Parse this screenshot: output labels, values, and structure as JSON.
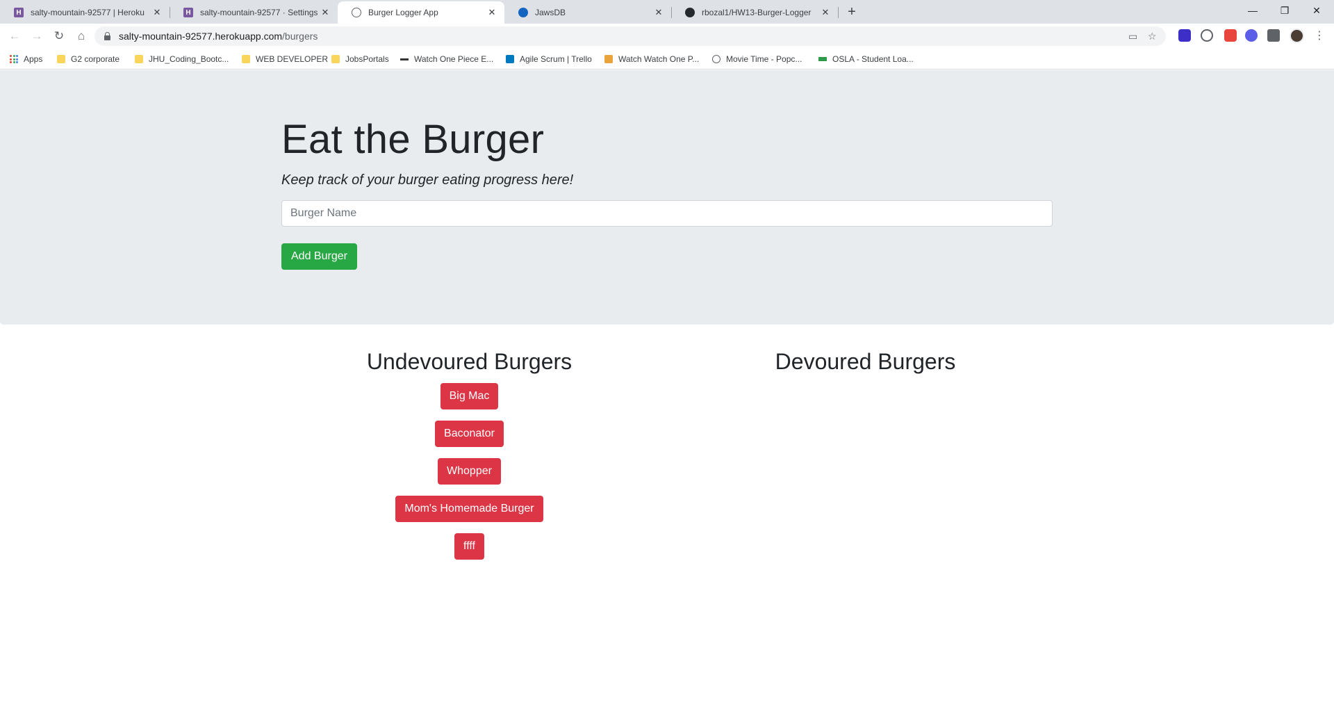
{
  "browser": {
    "tabs": [
      {
        "title": "salty-mountain-92577 | Heroku",
        "icon": "heroku-icon",
        "favicon_letter": "H",
        "close": "✕"
      },
      {
        "title": "salty-mountain-92577 · Settings |",
        "icon": "heroku-icon",
        "favicon_letter": "H",
        "close": "✕"
      },
      {
        "title": "Burger Logger App",
        "icon": "globe-icon",
        "close": "✕"
      },
      {
        "title": "JawsDB",
        "icon": "jawsdb-icon",
        "close": "✕"
      },
      {
        "title": "rbozal1/HW13-Burger-Logger",
        "icon": "github-icon",
        "close": "✕"
      }
    ],
    "new_tab": "+",
    "window_controls": {
      "minimize": "—",
      "restore": "❐",
      "close": "✕"
    },
    "nav": {
      "back": "←",
      "forward": "→",
      "reload": "↻",
      "home": "⌂"
    },
    "url": {
      "host": "salty-mountain-92577.herokuapp.com",
      "path": "/burgers"
    },
    "omnibox_icons": {
      "cast": "▭",
      "star": "☆"
    },
    "menu": "⋮",
    "extensions": [
      "extension-icon-1",
      "extension-icon-2",
      "extension-icon-3",
      "extension-icon-4",
      "puzzle-icon"
    ],
    "bookmarks": [
      {
        "label": "Apps",
        "icon": "apps-grid-icon"
      },
      {
        "label": "G2 corporate",
        "icon": "folder-icon"
      },
      {
        "label": "JHU_Coding_Bootc...",
        "icon": "folder-icon"
      },
      {
        "label": "WEB DEVELOPER",
        "icon": "folder-icon"
      },
      {
        "label": "JobsPortals",
        "icon": "folder-icon"
      },
      {
        "label": "Watch One Piece E...",
        "icon": "site-icon"
      },
      {
        "label": "Agile Scrum | Trello",
        "icon": "trello-icon"
      },
      {
        "label": "Watch Watch One P...",
        "icon": "site-icon"
      },
      {
        "label": "Movie Time - Popc...",
        "icon": "globe-icon"
      },
      {
        "label": "OSLA - Student Loa...",
        "icon": "site-icon"
      }
    ]
  },
  "page": {
    "title": "Eat the Burger",
    "lead": "Keep track of your burger eating progress here!",
    "input": {
      "placeholder": "Burger Name",
      "value": ""
    },
    "add_button": "Add Burger",
    "undevoured": {
      "title": "Undevoured Burgers",
      "items": [
        "Big Mac",
        "Baconator",
        "Whopper",
        "Mom's Homemade Burger",
        "ffff"
      ]
    },
    "devoured": {
      "title": "Devoured Burgers",
      "items": []
    }
  },
  "colors": {
    "jumbotron": "#e9ecef",
    "success": "#28a745",
    "danger": "#dc3545"
  }
}
